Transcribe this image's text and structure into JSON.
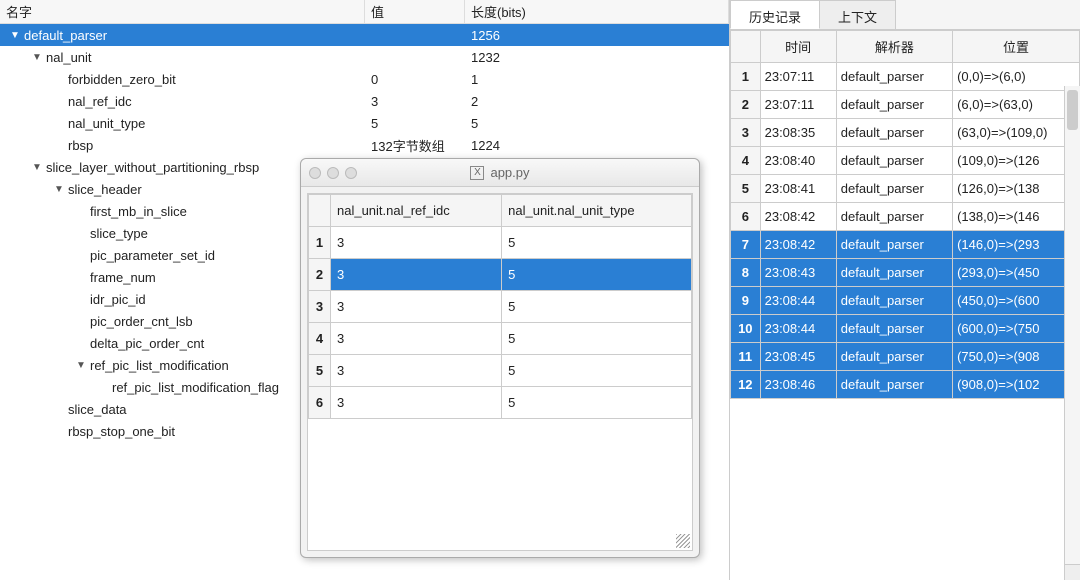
{
  "tree": {
    "headers": {
      "name": "名字",
      "value": "值",
      "length": "长度(bits)"
    },
    "rows": [
      {
        "indent": 0,
        "toggle": "▼",
        "name": "default_parser",
        "value": "",
        "length": "1256",
        "selected": true
      },
      {
        "indent": 1,
        "toggle": "▼",
        "name": "nal_unit",
        "value": "",
        "length": "1232"
      },
      {
        "indent": 2,
        "toggle": "",
        "name": "forbidden_zero_bit",
        "value": "0",
        "length": "1"
      },
      {
        "indent": 2,
        "toggle": "",
        "name": "nal_ref_idc",
        "value": "3",
        "length": "2"
      },
      {
        "indent": 2,
        "toggle": "",
        "name": "nal_unit_type",
        "value": "5",
        "length": "5"
      },
      {
        "indent": 2,
        "toggle": "",
        "name": "rbsp",
        "value": "132字节数组",
        "length": "1224"
      },
      {
        "indent": 1,
        "toggle": "▼",
        "name": "slice_layer_without_partitioning_rbsp",
        "value": "",
        "length": ""
      },
      {
        "indent": 2,
        "toggle": "▼",
        "name": "slice_header",
        "value": "",
        "length": ""
      },
      {
        "indent": 3,
        "toggle": "",
        "name": "first_mb_in_slice",
        "value": "",
        "length": ""
      },
      {
        "indent": 3,
        "toggle": "",
        "name": "slice_type",
        "value": "",
        "length": ""
      },
      {
        "indent": 3,
        "toggle": "",
        "name": "pic_parameter_set_id",
        "value": "",
        "length": ""
      },
      {
        "indent": 3,
        "toggle": "",
        "name": "frame_num",
        "value": "",
        "length": ""
      },
      {
        "indent": 3,
        "toggle": "",
        "name": "idr_pic_id",
        "value": "",
        "length": ""
      },
      {
        "indent": 3,
        "toggle": "",
        "name": "pic_order_cnt_lsb",
        "value": "",
        "length": ""
      },
      {
        "indent": 3,
        "toggle": "",
        "name": "delta_pic_order_cnt",
        "value": "",
        "length": ""
      },
      {
        "indent": 3,
        "toggle": "▼",
        "name": "ref_pic_list_modification",
        "value": "",
        "length": ""
      },
      {
        "indent": 4,
        "toggle": "",
        "name": "ref_pic_list_modification_flag",
        "value": "",
        "length": ""
      },
      {
        "indent": 2,
        "toggle": "",
        "name": "slice_data",
        "value": "",
        "length": ""
      },
      {
        "indent": 2,
        "toggle": "",
        "name": "rbsp_stop_one_bit",
        "value": "",
        "length": ""
      }
    ]
  },
  "tabs": {
    "history": "历史记录",
    "context": "上下文"
  },
  "history": {
    "headers": {
      "time": "时间",
      "parser": "解析器",
      "position": "位置"
    },
    "rows": [
      {
        "n": "1",
        "time": "23:07:11",
        "parser": "default_parser",
        "pos": "(0,0)=>(6,0)",
        "sel": false
      },
      {
        "n": "2",
        "time": "23:07:11",
        "parser": "default_parser",
        "pos": "(6,0)=>(63,0)",
        "sel": false
      },
      {
        "n": "3",
        "time": "23:08:35",
        "parser": "default_parser",
        "pos": "(63,0)=>(109,0)",
        "sel": false
      },
      {
        "n": "4",
        "time": "23:08:40",
        "parser": "default_parser",
        "pos": "(109,0)=>(126",
        "sel": false
      },
      {
        "n": "5",
        "time": "23:08:41",
        "parser": "default_parser",
        "pos": "(126,0)=>(138",
        "sel": false
      },
      {
        "n": "6",
        "time": "23:08:42",
        "parser": "default_parser",
        "pos": "(138,0)=>(146",
        "sel": false
      },
      {
        "n": "7",
        "time": "23:08:42",
        "parser": "default_parser",
        "pos": "(146,0)=>(293",
        "sel": true
      },
      {
        "n": "8",
        "time": "23:08:43",
        "parser": "default_parser",
        "pos": "(293,0)=>(450",
        "sel": true
      },
      {
        "n": "9",
        "time": "23:08:44",
        "parser": "default_parser",
        "pos": "(450,0)=>(600",
        "sel": true
      },
      {
        "n": "10",
        "time": "23:08:44",
        "parser": "default_parser",
        "pos": "(600,0)=>(750",
        "sel": true
      },
      {
        "n": "11",
        "time": "23:08:45",
        "parser": "default_parser",
        "pos": "(750,0)=>(908",
        "sel": true
      },
      {
        "n": "12",
        "time": "23:08:46",
        "parser": "default_parser",
        "pos": "(908,0)=>(102",
        "sel": true
      }
    ]
  },
  "popup": {
    "title": "app.py",
    "icon_letter": "X",
    "headers": {
      "col1": "nal_unit.nal_ref_idc",
      "col2": "nal_unit.nal_unit_type"
    },
    "rows": [
      {
        "n": "1",
        "c1": "3",
        "c2": "5",
        "sel": false
      },
      {
        "n": "2",
        "c1": "3",
        "c2": "5",
        "sel": true
      },
      {
        "n": "3",
        "c1": "3",
        "c2": "5",
        "sel": false
      },
      {
        "n": "4",
        "c1": "3",
        "c2": "5",
        "sel": false
      },
      {
        "n": "5",
        "c1": "3",
        "c2": "5",
        "sel": false
      },
      {
        "n": "6",
        "c1": "3",
        "c2": "5",
        "sel": false
      }
    ]
  }
}
